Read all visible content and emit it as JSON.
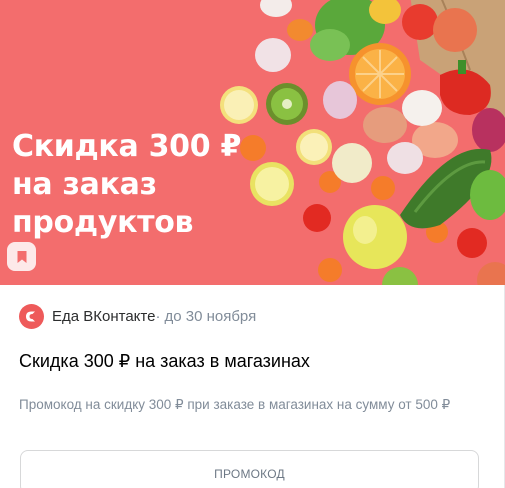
{
  "banner": {
    "title_lines": [
      "Скидка 300 ₽",
      "на заказ",
      "продуктов"
    ]
  },
  "icons": {
    "bookmark": "bookmark-icon",
    "source_logo": "vk-food-logo-icon"
  },
  "offer": {
    "source_name": "Еда ВКонтакте",
    "separator": "·",
    "deadline": "до 30 ноября",
    "title": "Скидка 300 ₽ на заказ в магазинах",
    "description": "Промокод на скидку 300 ₽ при заказе в магазинах на сумму от 500 ₽",
    "button_label": "ПРОМОКОД"
  },
  "colors": {
    "banner_bg": "#f36d6d",
    "logo": "#ee5a5a",
    "muted_text": "#818c99"
  }
}
